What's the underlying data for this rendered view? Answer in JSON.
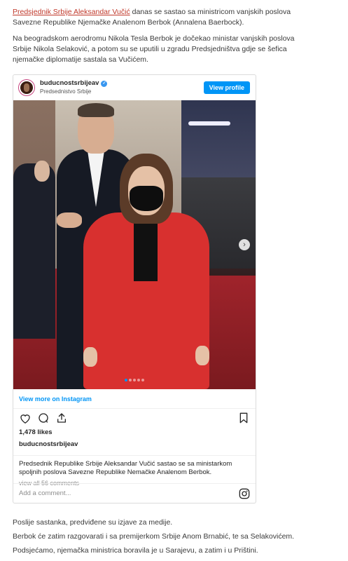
{
  "article": {
    "intro_link": "Predsjednik Srbije Aleksandar Vučić",
    "intro_rest": " danas se sastao sa ministricom vanjskih poslova Savezne Republike Njemačke Analenom Berbok (Annalena Baerbock).",
    "para2": "Na beogradskom aerodromu Nikola Tesla Berbok je dočekao ministar vanjskih poslova Srbije Nikola Selaković, a potom su se uputili u zgradu Predsjedništva gdje se šefica njemačke diplomatije sastala sa Vučićem.",
    "after": [
      "Poslije sastanka, predviđene su izjave za medije.",
      "Berbok će zatim razgovarati i sa premijerkom Srbije Anom Brnabić, te sa Selakovićem.",
      "Podsjećamo, njemačka ministrica boravila je u Sarajevu, a zatim i u Prištini."
    ]
  },
  "instagram": {
    "username": "buducnostsrbijeav",
    "subtitle": "Predsednistvo Srbije",
    "view_profile": "View profile",
    "view_more": "View more on Instagram",
    "likes": "1,478 likes",
    "caption_user": "buducnostsrbijeav",
    "caption": "Predsednik Republike Srbije Aleksandar Vučić sastao se sa ministarkom spoljnih poslova Savezne Republike Nemačke Analenom Berbok.",
    "comments_link": "view all 56 comments",
    "comment_placeholder": "Add a comment...",
    "carousel": {
      "total": 5,
      "active": 1
    },
    "icons": [
      "heart-icon",
      "comment-icon",
      "share-icon",
      "bookmark-icon",
      "instagram-icon",
      "verified-icon",
      "next-arrow-icon"
    ],
    "colors": {
      "accent": "#0095f6",
      "link": "#c0392b"
    }
  }
}
